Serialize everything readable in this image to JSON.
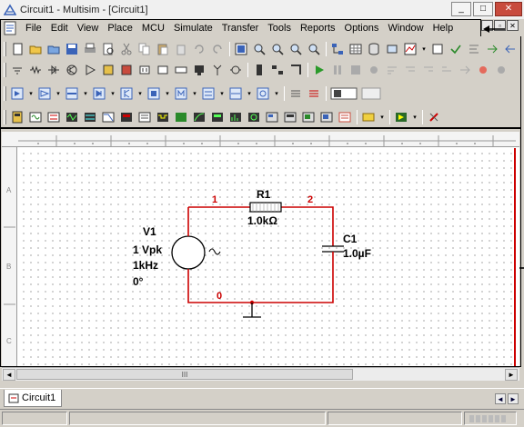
{
  "window": {
    "title": "Circuit1 - Multisim - [Circuit1]",
    "minimize": "_",
    "maximize": "□",
    "close": "✕",
    "doc_minimize": "_",
    "doc_restore": "▫",
    "doc_close": "✕"
  },
  "menu": {
    "items": [
      {
        "label": "File"
      },
      {
        "label": "Edit"
      },
      {
        "label": "View"
      },
      {
        "label": "Place"
      },
      {
        "label": "MCU"
      },
      {
        "label": "Simulate"
      },
      {
        "label": "Transfer"
      },
      {
        "label": "Tools"
      },
      {
        "label": "Reports"
      },
      {
        "label": "Options"
      },
      {
        "label": "Window"
      },
      {
        "label": "Help"
      }
    ]
  },
  "colors": {
    "wire": "#cc0000",
    "sheet_border": "#cc0000",
    "window_bg": "#d4d0c8"
  },
  "schematic": {
    "source": {
      "ref": "V1",
      "value": "1 Vpk",
      "frequency": "1kHz",
      "phase": "0°"
    },
    "resistor": {
      "ref": "R1",
      "value": "1.0kΩ"
    },
    "capacitor": {
      "ref": "C1",
      "value": "1.0µF"
    },
    "nets": {
      "n1": "1",
      "n2": "2",
      "n0": "0"
    }
  },
  "ruler": {
    "rows": [
      "A",
      "B",
      "C"
    ]
  },
  "tabs": {
    "active": "Circuit1"
  },
  "scroll": {
    "thumb_grip": "III"
  },
  "nav": {
    "prev": "◄",
    "next": "►"
  }
}
